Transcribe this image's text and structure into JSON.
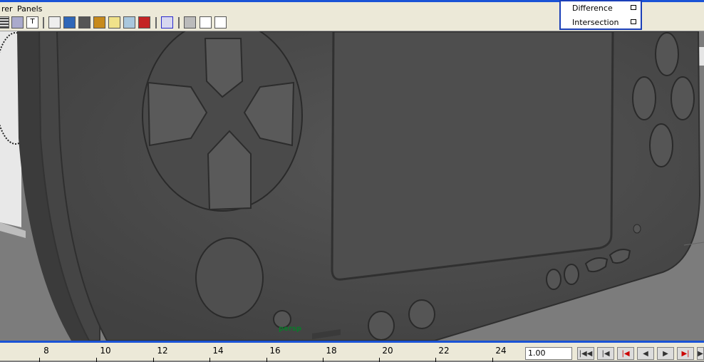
{
  "menu": {
    "items": [
      "rer",
      "Panels"
    ]
  },
  "toolbar": {
    "icons": [
      "grid-icon",
      "film-gate-icon",
      "text-icon",
      "wireframe-cube-icon",
      "smooth-shaded-cube-icon",
      "flat-shaded-cube-icon",
      "texture-icon",
      "light-bulb-icon",
      "xray-cube-icon",
      "red-cube-icon",
      "select-frame-icon",
      "isolate-cube-icon",
      "frame-all-icon",
      "camera-path-icon"
    ]
  },
  "popup": {
    "items": [
      {
        "label": "Difference"
      },
      {
        "label": "Intersection"
      }
    ]
  },
  "viewport": {
    "camera_label": "persp"
  },
  "timeline": {
    "ticks": [
      "8",
      "10",
      "12",
      "14",
      "16",
      "18",
      "20",
      "22",
      "24"
    ],
    "current_frame": "1.00",
    "playback_buttons": [
      "go-to-start-icon",
      "step-back-key-icon",
      "step-back-frame-icon",
      "play-backward-icon",
      "play-forward-icon",
      "step-forward-key-icon",
      "go-to-end-icon"
    ]
  },
  "colors": {
    "accent": "#1a53d6",
    "model": "#4d4d4d",
    "background": "#7f7f7f",
    "camera_label": "#0a7a2a"
  }
}
